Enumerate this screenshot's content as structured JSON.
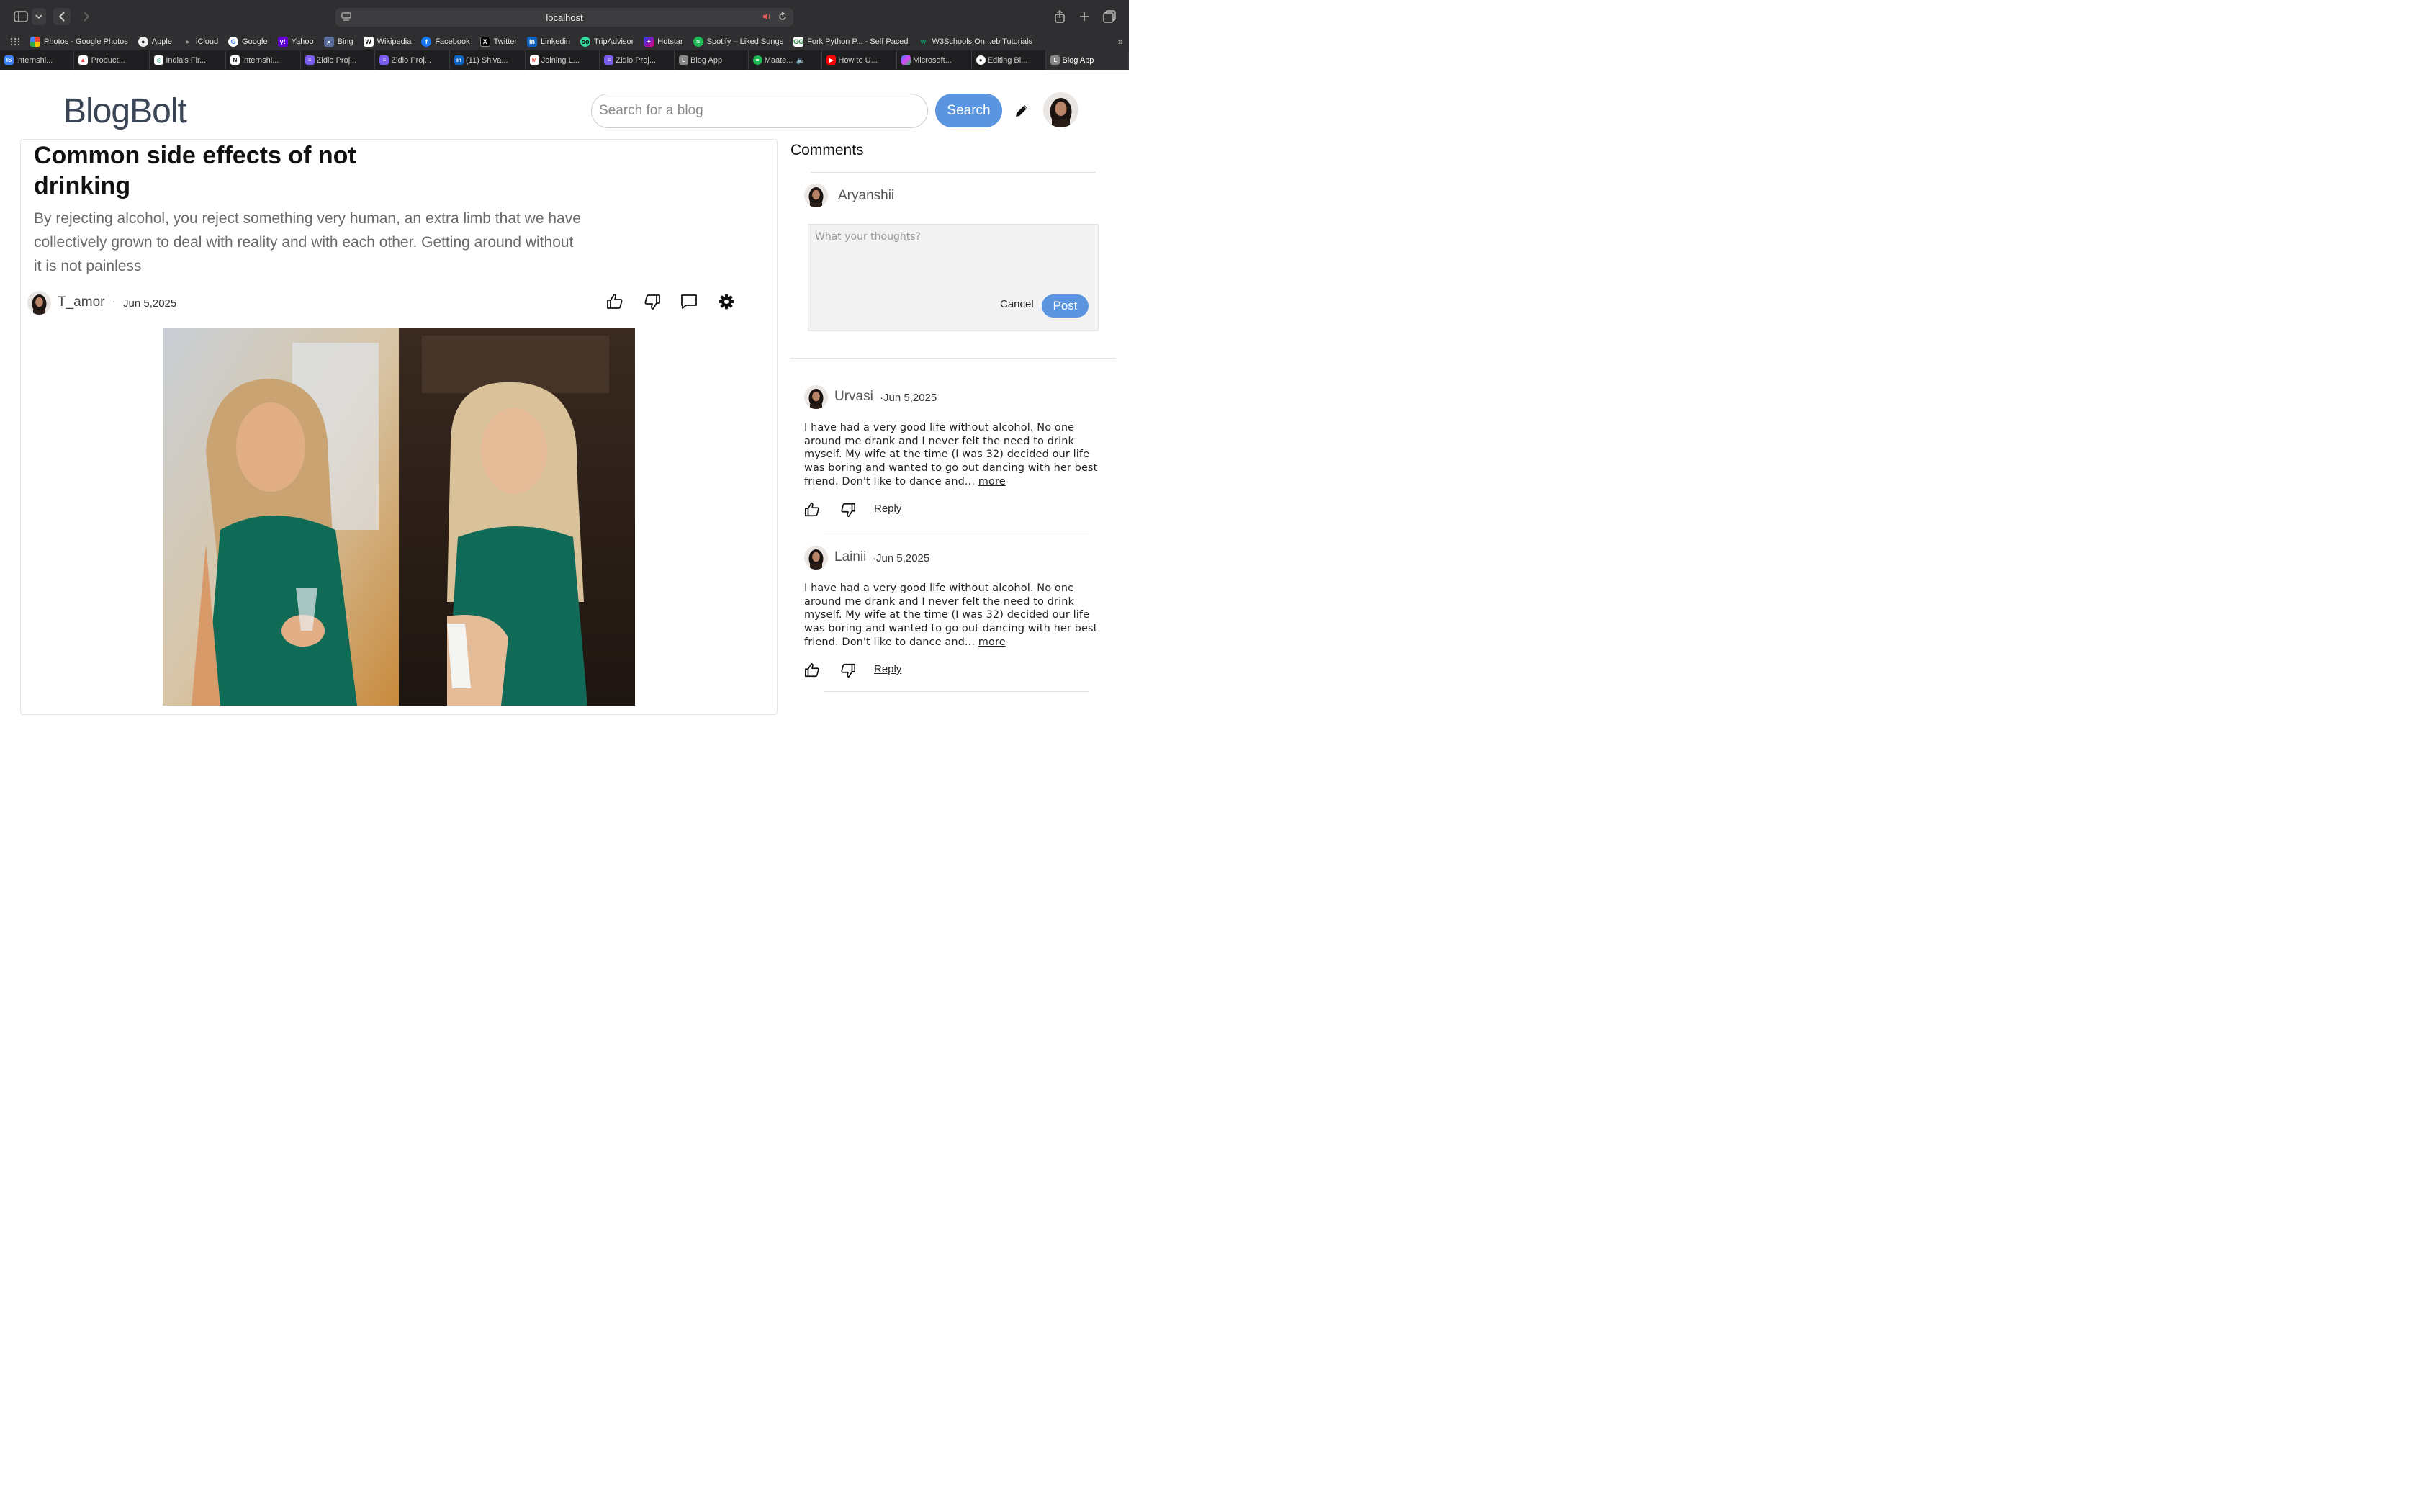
{
  "browser": {
    "url": "localhost",
    "bookmarks": [
      "Photos - Google Photos",
      "Apple",
      "iCloud",
      "Google",
      "Yahoo",
      "Bing",
      "Wikipedia",
      "Facebook",
      "Twitter",
      "Linkedin",
      "TripAdvisor",
      "Hotstar",
      "Spotify – Liked Songs",
      "Fork Python P... - Self Paced",
      "W3Schools On...eb Tutorials"
    ],
    "tabs": [
      "Internshi...",
      "Product...",
      "India's Fir...",
      "Internshi...",
      "Zidio Proj...",
      "Zidio Proj...",
      "(11) Shiva...",
      "Joining L...",
      "Zidio Proj...",
      "Blog App",
      "Maate...",
      "How to U...",
      "Microsoft...",
      "Editing Bl...",
      "Blog App"
    ]
  },
  "header": {
    "logo": "BlogBolt",
    "search_placeholder": "Search for a blog",
    "search_label": "Search"
  },
  "post": {
    "title": "Common side effects of not drinking",
    "subtitle": "By rejecting alcohol, you reject something very human, an extra limb that we have collectively grown to deal with reality and with each other. Getting around without it is not painless",
    "author": "T_amor",
    "separator": "·",
    "date": "Jun 5,2025"
  },
  "comments": {
    "title": "Comments",
    "current_user": "Aryanshii",
    "input_placeholder": "What your thoughts?",
    "cancel_label": "Cancel",
    "post_label": "Post",
    "items": [
      {
        "name": "Urvasi",
        "date": "·Jun 5,2025",
        "text": "I have had a very good life without alcohol. No one around me drank and I never felt the need to drink myself. My wife at the time (I was 32) decided our life was boring and wanted to go out dancing with her best friend. Don't like to dance and...",
        "more": "more",
        "reply": "Reply"
      },
      {
        "name": "Lainii",
        "date": "·Jun 5,2025",
        "text": "I have had a very good life without alcohol. No one around me drank and I never felt the need to drink myself. My wife at the time (I was 32) decided our life was boring and wanted to go out dancing with her best friend. Don't like to dance and...",
        "more": "more",
        "reply": "Reply"
      }
    ]
  }
}
